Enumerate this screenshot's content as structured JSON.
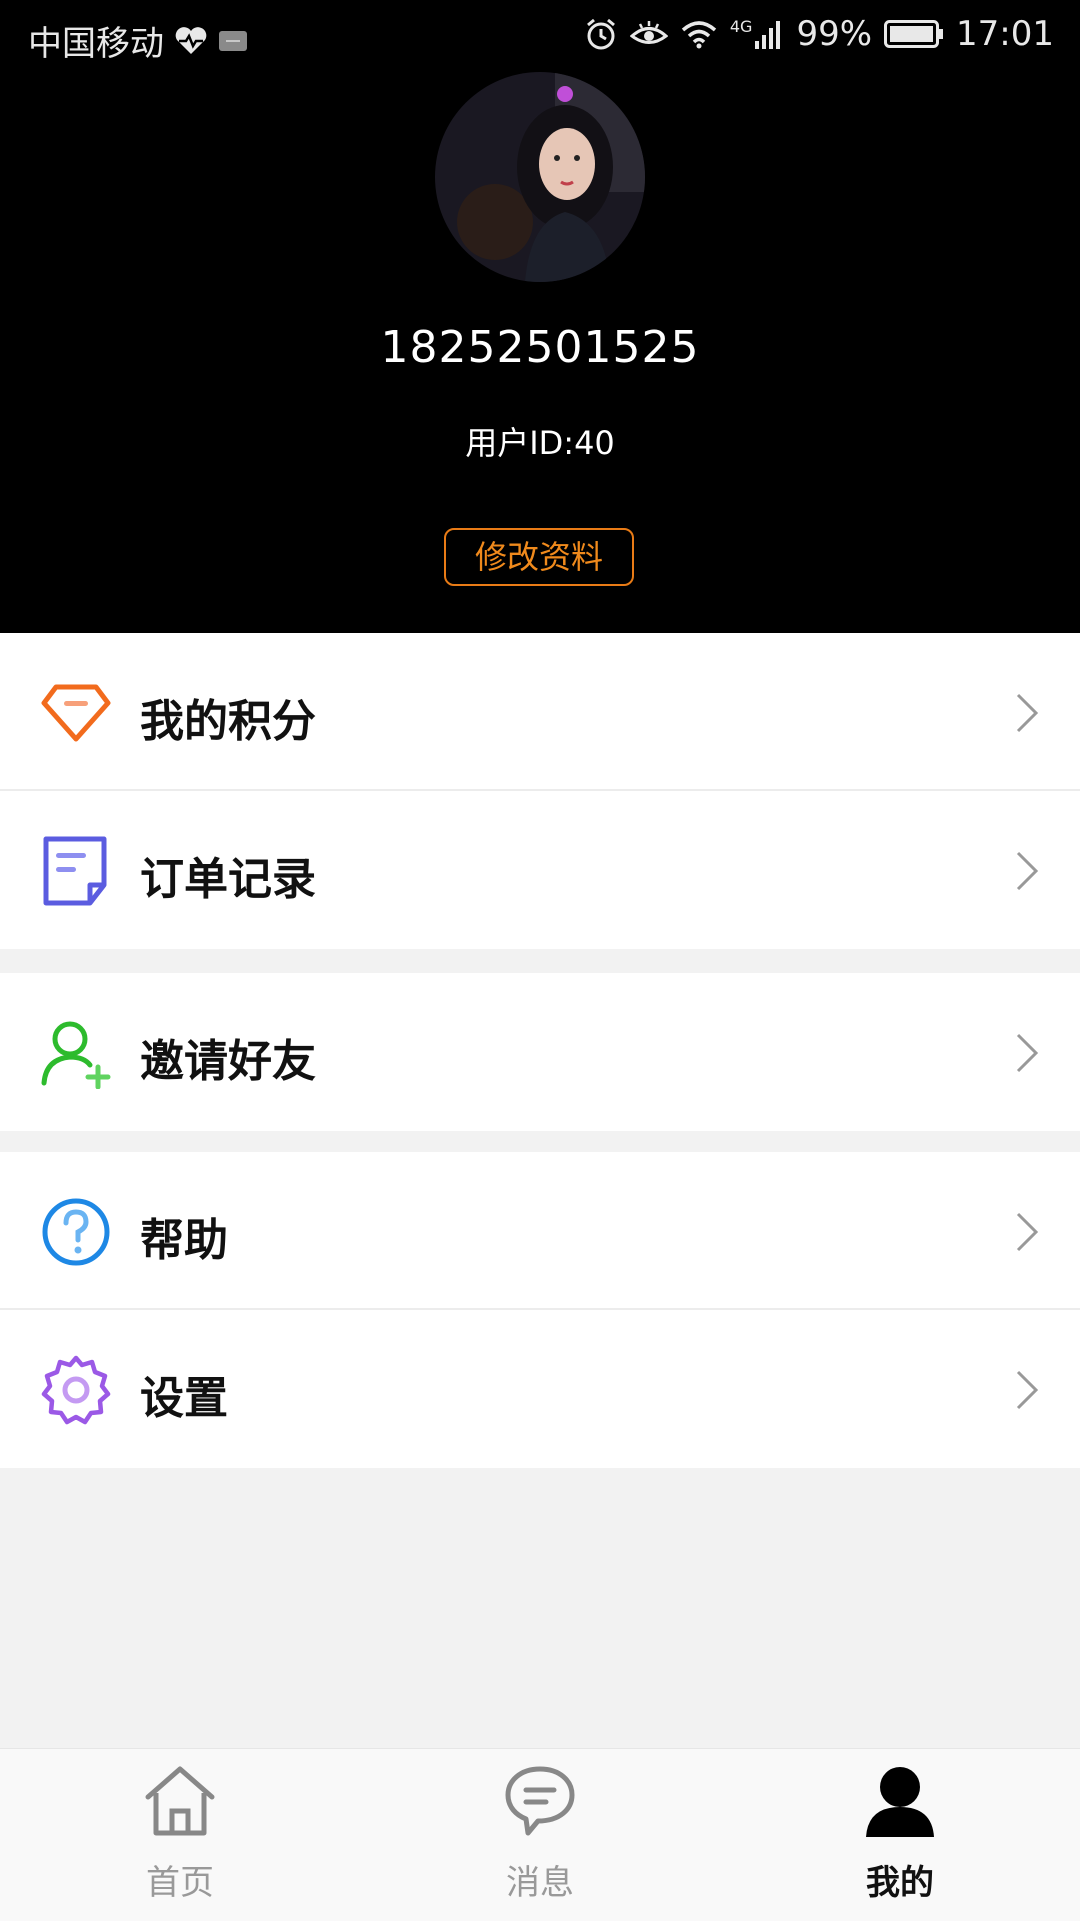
{
  "status_bar": {
    "carrier": "中国移动",
    "network": "4G",
    "battery": "99%",
    "time": "17:01"
  },
  "profile": {
    "phone": "18252501525",
    "user_id": "用户ID:40",
    "edit_label": "修改资料"
  },
  "menu": {
    "points": "我的积分",
    "orders": "订单记录",
    "invite": "邀请好友",
    "help": "帮助",
    "settings": "设置"
  },
  "nav": {
    "home": "首页",
    "messages": "消息",
    "mine": "我的",
    "active": "mine"
  },
  "colors": {
    "accent": "#f08a1c",
    "points_icon": "#f26b1d",
    "orders_icon": "#5b5ce0",
    "invite_icon": "#2dbb2d",
    "help_icon": "#1e88e5",
    "settings_icon": "#9b59e6"
  }
}
